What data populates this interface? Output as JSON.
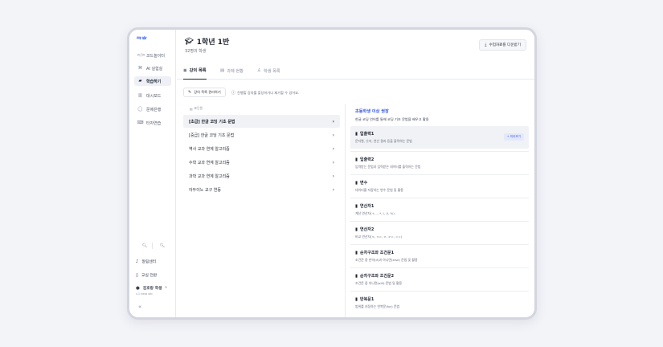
{
  "sidebar": {
    "logo": "ᄏᄒ",
    "items": [
      {
        "label": "코드놀이터",
        "icon": "code-icon"
      },
      {
        "label": "AI 실험실",
        "icon": "ai-chip-icon"
      },
      {
        "label": "학습하기",
        "icon": "study-icon"
      },
      {
        "label": "대시보드",
        "icon": "dashboard-icon"
      },
      {
        "label": "문제은행",
        "icon": "chat-icon"
      },
      {
        "label": "타자연습",
        "icon": "keyboard-icon"
      }
    ],
    "bottom": {
      "help": "알림센터",
      "classroom": "교실 전환",
      "user": "김호랑 학생",
      "user_sub": "v.1 beta lab"
    }
  },
  "header": {
    "title": "1학년 1반",
    "subtitle": "32명의 학생",
    "download_label": "수업자료를 다운받기"
  },
  "tabs": [
    {
      "label": "강의 목록",
      "icon": "list-icon"
    },
    {
      "label": "과제 현황",
      "icon": "clipboard-icon"
    },
    {
      "label": "학생 목록",
      "icon": "person-icon"
    }
  ],
  "toolbar": {
    "manage_label": "강의 목록 관리하기",
    "hint": "진행할 강의를 할당하거나 제거할 수 있어요."
  },
  "lecture_list": {
    "header": "표단원",
    "items": [
      "[초급] 한글 코딩 기초 문법",
      "[중급] 한글 코딩 기초 문법",
      "역사 교과 연계 알고리즘",
      "수학 교과 연계 알고리즘",
      "과학 교과 연계 알고리즘",
      "아두이노 교구 연동"
    ]
  },
  "detail": {
    "title": "초등학생 이상 권장",
    "subtitle": "한글 코딩 언어를 통해 코딩 기초 문법을 배우고 활용",
    "topics": [
      {
        "title": "입출력1",
        "desc": "문자열, 숫자, 연산 결과 등을 출력하는 문법",
        "button": "+ 미리보기"
      },
      {
        "title": "입출력2",
        "desc": "입력받는 문법과 입력받은 데이터를 출력하는 문법"
      },
      {
        "title": "변수",
        "desc": "데이터를 저장하는 변수 문법 및 활용"
      },
      {
        "title": "연산자1",
        "desc": "계산 연산자(+, -, *, /, //, %)"
      },
      {
        "title": "연산자2",
        "desc": "비교 연산자(<, <=, >, >=, ==)"
      },
      {
        "title": "순차구조와 조건문1",
        "desc": "조건문 중 만약(if)과 아니면(else) 문법 및 활용"
      },
      {
        "title": "순차구조와 조건문2",
        "desc": "조건문 중 아니면(elif) 문법 및 활용"
      },
      {
        "title": "반복문1",
        "desc": "범위를 지정하는 반복문(for) 문법"
      }
    ]
  },
  "colors": {
    "accent": "#3a5bd9",
    "active_row": "#f1f2f5"
  }
}
